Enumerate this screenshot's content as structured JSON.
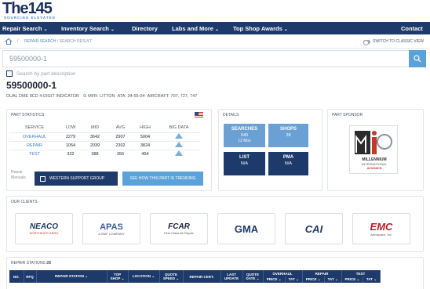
{
  "brand": {
    "name": "The",
    "number": "145",
    "tagline": "SOURCING ELEVATED"
  },
  "nav": [
    {
      "label": "Repair Search",
      "chevron": true
    },
    {
      "label": "Inventory Search",
      "chevron": true
    },
    {
      "label": "Directory",
      "chevron": false
    },
    {
      "label": "Labs and More",
      "chevron": true
    },
    {
      "label": "Top Shop Awards",
      "chevron": true
    },
    {
      "label": "Contact",
      "chevron": false
    }
  ],
  "breadcrumb": {
    "sep": "/",
    "link": "REPAIR SEARCH",
    "current": "/ SEARCH RESULT"
  },
  "classic_toggle": "SWITCH TO CLASSIC VIEW",
  "search": {
    "value": "59500000-1"
  },
  "desc_search_label": "Search by part description",
  "part": {
    "number": "59500000-1",
    "description": "DUAL DME 8CD 4-DIGIT INDICATOR",
    "mfr": "MFR: LITTON",
    "ata": "ATA: 34-55-04",
    "aircraft": "AIRCRAFT: 707, 727, 747"
  },
  "stats": {
    "title": "PART STATISTICS",
    "headers": [
      "SERVICE",
      "LOW",
      "MID",
      "AVG",
      "HIGH",
      "BIG DATA"
    ],
    "rows": [
      {
        "service": "OVERHAUL",
        "low": "2279",
        "mid": "3642",
        "avg": "2907",
        "high": "5004"
      },
      {
        "service": "REPAIR",
        "low": "1054",
        "mid": "2039",
        "avg": "2302",
        "high": "3824"
      },
      {
        "service": "TEST",
        "low": "322",
        "mid": "388",
        "avg": "356",
        "high": "454"
      }
    ],
    "manuals_label": "Repair Manuals",
    "support_btn": "WESTERN SUPPORT GROUP",
    "trend_btn": "SEE HOW THIS PART IS TRENDING"
  },
  "details": {
    "title": "DETAILS",
    "searches": {
      "label": "SEARCHES",
      "count": "540",
      "period": "12 Mos"
    },
    "shops": {
      "label": "SHOPS",
      "count": "28"
    },
    "list": {
      "label": "LIST",
      "value": "N/A"
    },
    "pma": {
      "label": "PMA",
      "value": "N/A"
    }
  },
  "sponsor": {
    "title": "PART SPONSOR",
    "name": "MILLENNIUM",
    "sub": "INTERNATIONAL",
    "tag": "AVIONICS"
  },
  "clients": {
    "title": "OUR CLIENTS",
    "logos": [
      {
        "name": "NEACO",
        "sub": "NORTHEAST AERO"
      },
      {
        "name": "APAS",
        "sub": "a GMF COMPANY"
      },
      {
        "name": "FCAR",
        "sub": "First Class Air Repair"
      },
      {
        "name": "GMA",
        "sub": ""
      },
      {
        "name": "CAI",
        "sub": ""
      },
      {
        "name": "EMC",
        "sub": "Aerospace, Inc."
      }
    ]
  },
  "repair_stations": {
    "title": "REPAIR STATIONS",
    "count": "28",
    "columns": [
      "NO.",
      "RFQ",
      "REPAIR STATION",
      "TOP SHOP",
      "LOCATION",
      "QUOTE SPEED",
      "REPAIR CERT.",
      "LAST UPDATE",
      "QUOTE DATE"
    ],
    "groups": [
      "OVERHAUL",
      "REPAIR",
      "TEST"
    ],
    "sub": [
      "PRICE",
      "TAT"
    ]
  },
  "colors": {
    "navy": "#1d3a6b",
    "light_blue": "#5aa2d8",
    "tile_blue": "#6aa0d4"
  }
}
